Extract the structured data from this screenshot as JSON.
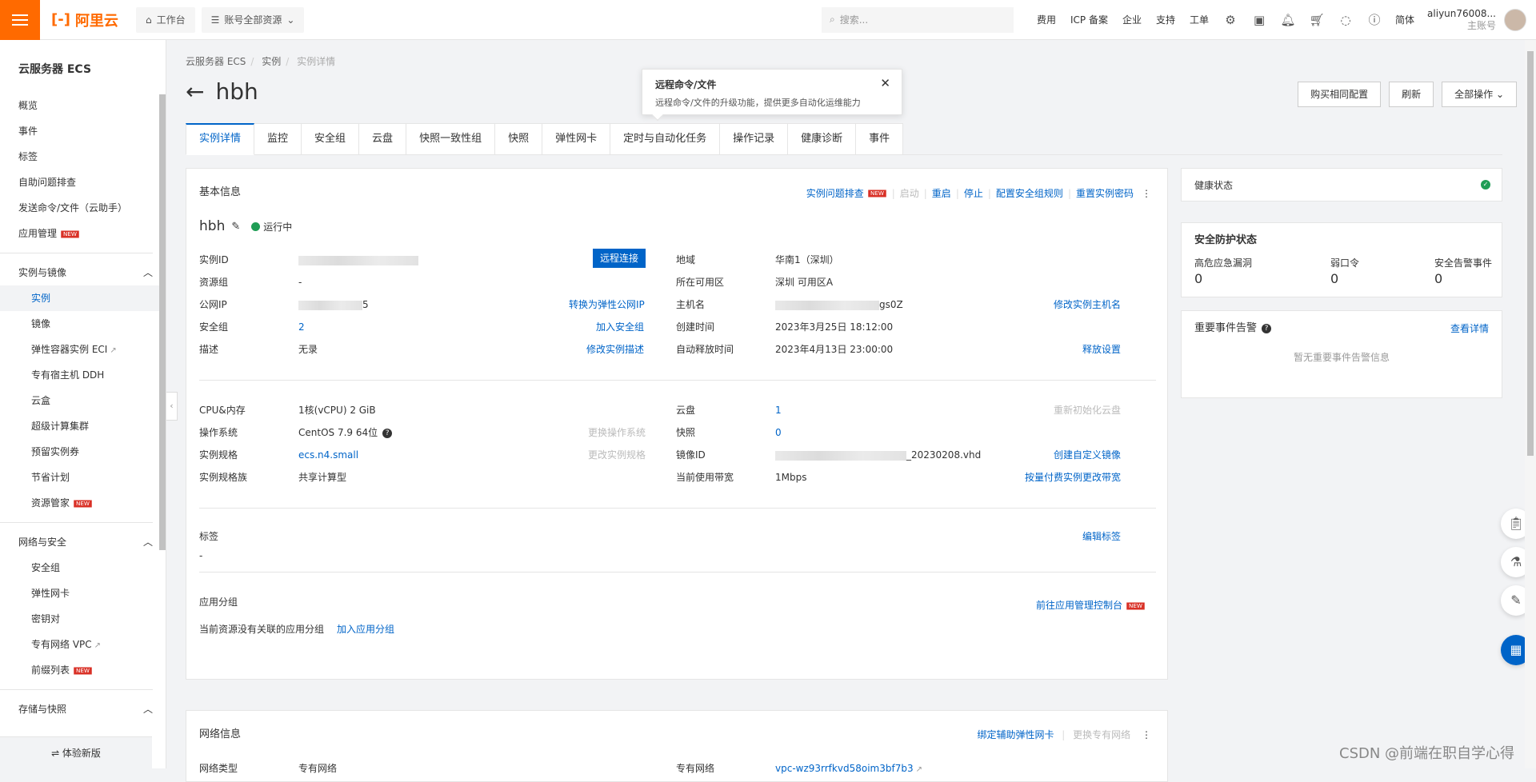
{
  "topbar": {
    "logo_text": "阿里云",
    "workbench": "工作台",
    "resources": "账号全部资源",
    "search_placeholder": "搜索...",
    "links": [
      "费用",
      "ICP 备案",
      "企业",
      "支持",
      "工单"
    ],
    "lang": "简体",
    "account_name": "aliyun76008...",
    "account_sub": "主账号"
  },
  "sidebar": {
    "title": "云服务器 ECS",
    "top_items": [
      "概览",
      "事件",
      "标签",
      "自助问题排查",
      "发送命令/文件（云助手）",
      "应用管理"
    ],
    "group1": {
      "title": "实例与镜像",
      "items": [
        "实例",
        "镜像",
        "弹性容器实例 ECI",
        "专有宿主机 DDH",
        "云盒",
        "超级计算集群",
        "预留实例券",
        "节省计划",
        "资源管家"
      ]
    },
    "group2": {
      "title": "网络与安全",
      "items": [
        "安全组",
        "弹性网卡",
        "密钥对",
        "专有网络 VPC",
        "前缀列表"
      ]
    },
    "group3": {
      "title": "存储与快照"
    },
    "badge": "NEW",
    "footer": "⇌ 体验新版"
  },
  "main": {
    "breadcrumb": [
      "云服务器 ECS",
      "实例",
      "实例详情"
    ],
    "title": "hbh",
    "tooltip": {
      "title": "远程命令/文件",
      "text": "远程命令/文件的升级功能，提供更多自动化运维能力"
    },
    "actions": [
      "购买相同配置",
      "刷新",
      "全部操作"
    ],
    "tabs": [
      "实例详情",
      "监控",
      "安全组",
      "云盘",
      "快照一致性组",
      "快照",
      "弹性网卡",
      "定时与自动化任务",
      "操作记录",
      "健康诊断",
      "事件"
    ]
  },
  "basic": {
    "heading": "基本信息",
    "actions": [
      "实例问题排查",
      "启动",
      "重启",
      "停止",
      "配置安全组规则",
      "重置实例密码"
    ],
    "instance_name": "hbh",
    "status": "运行中",
    "remote_connect": "远程连接",
    "left": [
      {
        "label": "实例ID",
        "value": "",
        "action": ""
      },
      {
        "label": "资源组",
        "value": "-",
        "action": ""
      },
      {
        "label": "公网IP",
        "value": "5",
        "action": "转换为弹性公网IP"
      },
      {
        "label": "安全组",
        "value": "2",
        "action": "加入安全组"
      },
      {
        "label": "描述",
        "value": "无录",
        "action": "修改实例描述"
      }
    ],
    "right": [
      {
        "label": "地域",
        "value": "华南1（深圳）",
        "action": ""
      },
      {
        "label": "所在可用区",
        "value": "深圳 可用区A",
        "action": ""
      },
      {
        "label": "主机名",
        "value": "gs0Z",
        "action": "修改实例主机名"
      },
      {
        "label": "创建时间",
        "value": "2023年3月25日 18:12:00",
        "action": ""
      },
      {
        "label": "自动释放时间",
        "value": "2023年4月13日 23:00:00",
        "action": "释放设置"
      }
    ],
    "left2": [
      {
        "label": "CPU&内存",
        "value": "1核(vCPU) 2 GiB",
        "action": ""
      },
      {
        "label": "操作系统",
        "value": "CentOS 7.9 64位",
        "action": "更换操作系统"
      },
      {
        "label": "实例规格",
        "value": "ecs.n4.small",
        "action": "更改实例规格"
      },
      {
        "label": "实例规格族",
        "value": "共享计算型",
        "action": ""
      }
    ],
    "right2": [
      {
        "label": "云盘",
        "value": "1",
        "action": "重新初始化云盘"
      },
      {
        "label": "快照",
        "value": "0",
        "action": ""
      },
      {
        "label": "镜像ID",
        "value": "_20230208.vhd",
        "action": "创建自定义镜像"
      },
      {
        "label": "当前使用带宽",
        "value": "1Mbps",
        "action": "按量付费实例更改带宽"
      }
    ],
    "tags_label": "标签",
    "tags_value": "-",
    "tags_action": "编辑标签",
    "app_group_label": "应用分组",
    "app_group_action": "前往应用管理控制台",
    "app_group_empty": "当前资源没有关联的应用分组",
    "app_group_add": "加入应用分组"
  },
  "right_panel": {
    "health": "健康状态",
    "security_title": "安全防护状态",
    "security_items": [
      {
        "label": "高危应急漏洞",
        "value": "0"
      },
      {
        "label": "弱口令",
        "value": "0"
      },
      {
        "label": "安全告警事件",
        "value": "0"
      }
    ],
    "events_title": "重要事件告警",
    "events_link": "查看详情",
    "events_empty": "暂无重要事件告警信息"
  },
  "network": {
    "heading": "网络信息",
    "actions": [
      "绑定辅助弹性网卡",
      "更换专有网络"
    ],
    "type_label": "网络类型",
    "type_value": "专有网络",
    "vpc_label": "专有网络",
    "vpc_value": "vpc-wz93rrfkvd58oim3bf7b3"
  },
  "watermark": "CSDN @前端在职自学心得",
  "colors": {
    "brand": "#ff6a00",
    "link": "#0064c8",
    "running": "#1f9d55",
    "new_badge": "#d93026"
  }
}
